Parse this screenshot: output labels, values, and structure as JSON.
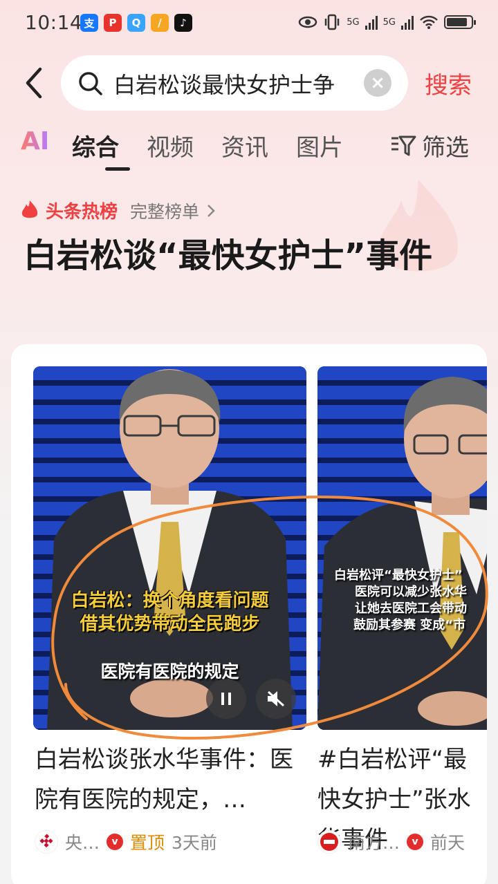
{
  "status_bar": {
    "time": "10:14",
    "apps": [
      {
        "name": "alipay-icon",
        "glyph": "支",
        "color": "#1677ff"
      },
      {
        "name": "app-red-icon",
        "glyph": "P",
        "color": "#e8322c"
      },
      {
        "name": "app-chat-icon",
        "glyph": "Q",
        "color": "#3aa3ff"
      },
      {
        "name": "app-orange-icon",
        "glyph": "/",
        "color": "#f6a623"
      },
      {
        "name": "tiktok-icon",
        "glyph": "♪",
        "color": "#111111"
      }
    ],
    "signal1": "5G",
    "signal2": "5G",
    "battery_level": 0.85
  },
  "search": {
    "query": "白岩松谈最快女护士争",
    "button_label": "搜索"
  },
  "tabs": {
    "ai": "AI",
    "items": [
      "综合",
      "视频",
      "资讯",
      "图片"
    ],
    "active": "综合",
    "filter": "筛选"
  },
  "hot": {
    "label": "头条热榜",
    "full_list": "完整榜单",
    "headline": "白岩松谈“最快女护士”事件"
  },
  "cards": [
    {
      "title": "白岩松谈张水华事件：医院有医院的规定，…",
      "caption_line1": "白岩松：换个角度看问题",
      "caption_line2": "借其优势带动全民跑步",
      "subtitle": "医院有医院的规定",
      "source": "央…",
      "pinned": "置顶",
      "time": "3天前"
    },
    {
      "title": "#白岩松评“最快女护士”张水华事件",
      "caption_line1": "白岩松评“最快女护士”",
      "caption_line2": "医院可以减少张水华",
      "caption_line3": "让她去医院工会带动",
      "caption_line4": "鼓励其参赛 变成“市",
      "source": "南方…",
      "time": "前天"
    }
  ],
  "colors": {
    "accent": "#f04142",
    "annotation": "#f08a3c",
    "pinned": "#e08a00"
  }
}
